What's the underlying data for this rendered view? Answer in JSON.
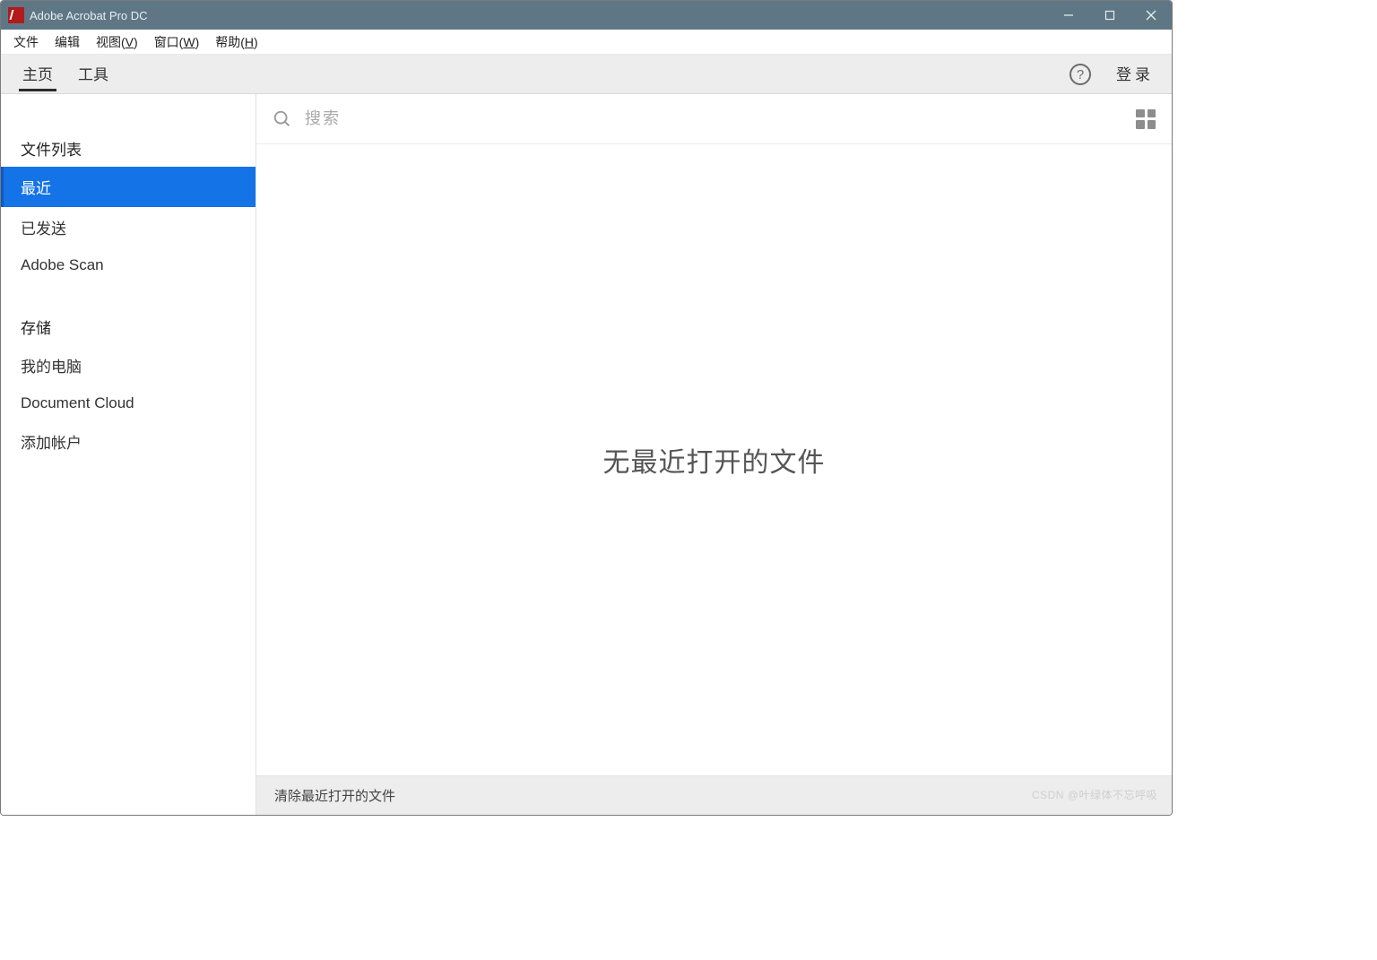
{
  "titlebar": {
    "title": "Adobe Acrobat Pro DC"
  },
  "menubar": {
    "file": "文件",
    "edit": "编辑",
    "view_pre": "视图(",
    "view_u": "V",
    "view_post": ")",
    "window_pre": "窗口(",
    "window_u": "W",
    "window_post": ")",
    "help_pre": "帮助(",
    "help_u": "H",
    "help_post": ")"
  },
  "tabs": {
    "home": "主页",
    "tools": "工具",
    "help_glyph": "?",
    "login": "登录"
  },
  "sidebar": {
    "section_files": "文件列表",
    "recent": "最近",
    "sent": "已发送",
    "scan": "Adobe Scan",
    "section_storage": "存储",
    "mycomputer": "我的电脑",
    "doccloud": "Document Cloud",
    "addaccount": "添加帐户"
  },
  "search": {
    "placeholder": "搜索"
  },
  "main": {
    "empty": "无最近打开的文件"
  },
  "footer": {
    "clear_recent": "清除最近打开的文件"
  },
  "watermark": "CSDN @叶绿体不忘呼吸"
}
